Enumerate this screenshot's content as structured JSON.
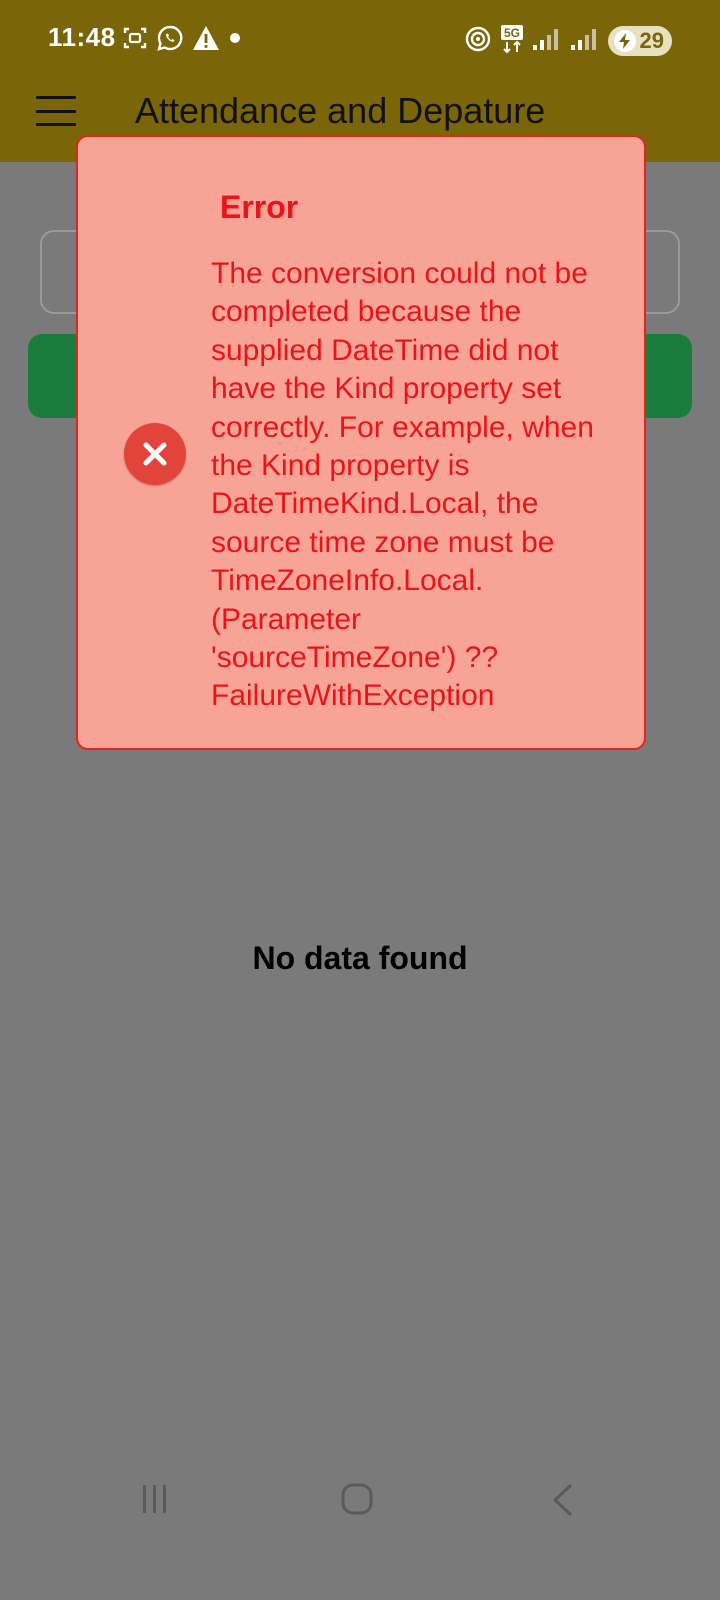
{
  "status_bar": {
    "time": "11:48",
    "network": "5G",
    "battery": "29"
  },
  "app_bar": {
    "title": "Attendance and Depature"
  },
  "main": {
    "empty_message": "No data found"
  },
  "dialog": {
    "title": "Error",
    "message": "The conversion could not be completed because the supplied DateTime did not have the Kind property set correctly.  For example, when the Kind property is DateTimeKind.Local, the source time zone must be TimeZoneInfo.Local. (Parameter 'sourceTimeZone') ?? FailureWithException"
  },
  "colors": {
    "app_bar": "#7a6508",
    "dialog_bg": "#f7a496",
    "dialog_text": "#e8141a",
    "overlay": "#7a7a7a",
    "button": "#1b7d3d"
  }
}
